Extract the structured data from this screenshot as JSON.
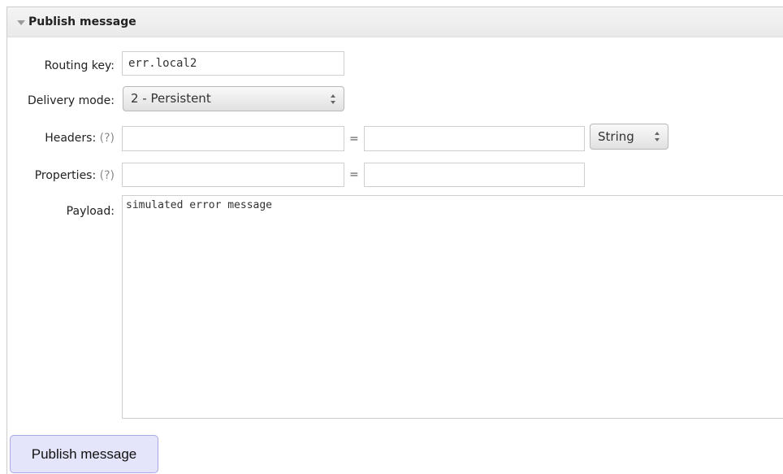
{
  "section": {
    "title": "Publish message"
  },
  "form": {
    "routing_key": {
      "label": "Routing key:",
      "value": "err.local2"
    },
    "delivery_mode": {
      "label": "Delivery mode:",
      "selected": "2 - Persistent"
    },
    "headers": {
      "label": "Headers:",
      "help": "(?)",
      "equals": "=",
      "key": "",
      "value": "",
      "type_selected": "String"
    },
    "properties": {
      "label": "Properties:",
      "help": "(?)",
      "equals": "=",
      "key": "",
      "value": ""
    },
    "payload": {
      "label": "Payload:",
      "value": "simulated error message"
    }
  },
  "actions": {
    "publish_label": "Publish message"
  },
  "icons": {
    "section_toggle": "caret-down-icon",
    "select_arrows": "up-down-arrows-icon"
  }
}
